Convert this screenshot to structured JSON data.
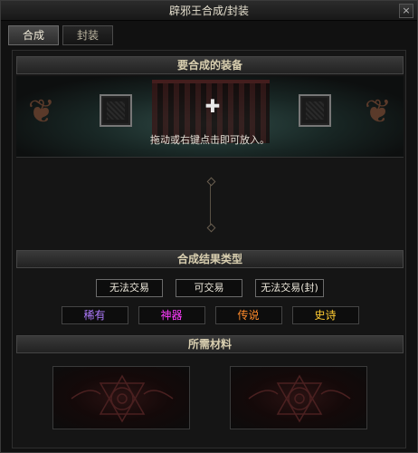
{
  "window": {
    "title": "辟邪王合成/封装",
    "close_label": "×"
  },
  "tabs": [
    {
      "label": "合成",
      "active": true
    },
    {
      "label": "封装",
      "active": false
    }
  ],
  "equip_section": {
    "header": "要合成的装备",
    "hint": "拖动或右键点击即可放入。"
  },
  "result_section": {
    "header": "合成结果类型",
    "trade_options": [
      "无法交易",
      "可交易",
      "无法交易(封)"
    ],
    "rarity_options": [
      {
        "label": "稀有",
        "color": "#b07cff"
      },
      {
        "label": "神器",
        "color": "#ff3cff"
      },
      {
        "label": "传说",
        "color": "#ff8a2a"
      },
      {
        "label": "史诗",
        "color": "#ffcc33"
      }
    ]
  },
  "materials_section": {
    "header": "所需材料"
  }
}
